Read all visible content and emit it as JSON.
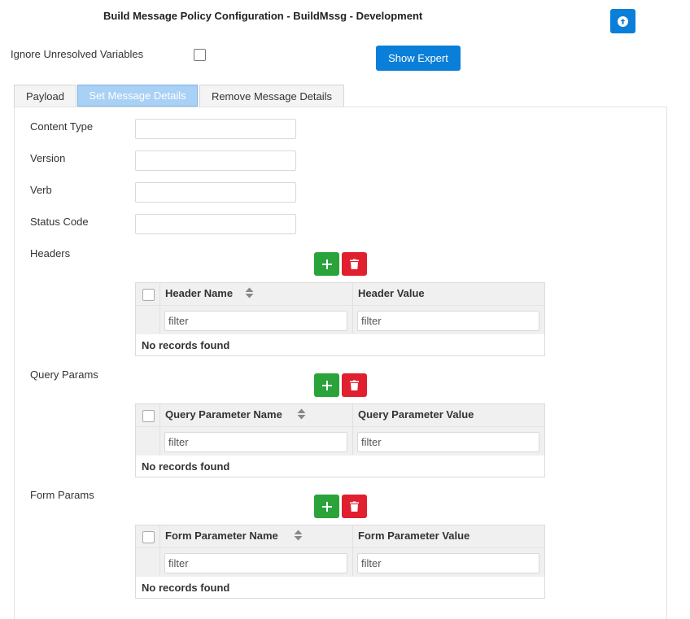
{
  "header": {
    "title": "Build Message Policy Configuration - BuildMssg - Development"
  },
  "options": {
    "ignore_label": "Ignore Unresolved Variables",
    "show_expert_label": "Show Expert"
  },
  "tabs": [
    {
      "label": "Payload"
    },
    {
      "label": "Set Message Details",
      "active": true
    },
    {
      "label": "Remove Message Details"
    }
  ],
  "fields": {
    "content_type": {
      "label": "Content Type",
      "value": ""
    },
    "version": {
      "label": "Version",
      "value": ""
    },
    "verb": {
      "label": "Verb",
      "value": ""
    },
    "status_code": {
      "label": "Status Code",
      "value": ""
    }
  },
  "headers": {
    "label": "Headers",
    "col1": "Header Name",
    "col2": "Header Value",
    "filter_placeholder": "filter",
    "empty": "No records found"
  },
  "query_params": {
    "label": "Query Params",
    "col1": "Query Parameter Name",
    "col2": "Query Parameter Value",
    "filter_placeholder": "filter",
    "empty": "No records found"
  },
  "form_params": {
    "label": "Form Params",
    "col1": "Form Parameter Name",
    "col2": "Form Parameter Value",
    "filter_placeholder": "filter",
    "empty": "No records found"
  },
  "colors": {
    "primary": "#0a7fd9",
    "add": "#2aa33b",
    "delete": "#e0202e",
    "active_tab": "#a9d0f5"
  },
  "icons": {
    "top_button": "arrow-up-circle-icon",
    "add": "plus-icon",
    "delete": "trash-icon",
    "sort": "sort-icon"
  }
}
